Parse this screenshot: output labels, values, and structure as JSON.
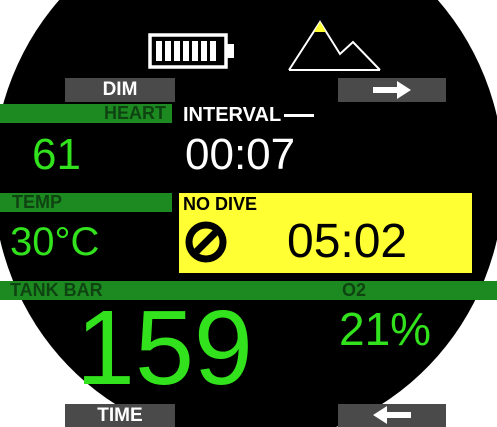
{
  "colors": {
    "background": "#000000",
    "value_green": "#31e21c",
    "band_green": "#1c8a20",
    "band_text": "#0f4412",
    "nodive_yellow": "#ffff33",
    "button_gray": "#4a4a4a",
    "white": "#ffffff"
  },
  "status": {
    "battery_icon": "battery-full-icon",
    "battery_level": 1.0,
    "altitude_icon": "mountain-icon"
  },
  "buttons": {
    "top_left_label": "DIM",
    "top_right_icon": "arrow-right-icon",
    "bottom_left_label": "TIME",
    "bottom_right_icon": "arrow-left-icon"
  },
  "heart": {
    "label": "HEART",
    "value": "61"
  },
  "interval": {
    "label": "INTERVAL",
    "value": "00:07"
  },
  "temp": {
    "label": "TEMP",
    "value": "30°C"
  },
  "no_dive": {
    "label": "NO DIVE",
    "icon": "no-entry-icon",
    "value": "05:02"
  },
  "tank": {
    "label": "TANK BAR",
    "value": "159"
  },
  "o2": {
    "label": "O2",
    "value": "21%"
  }
}
